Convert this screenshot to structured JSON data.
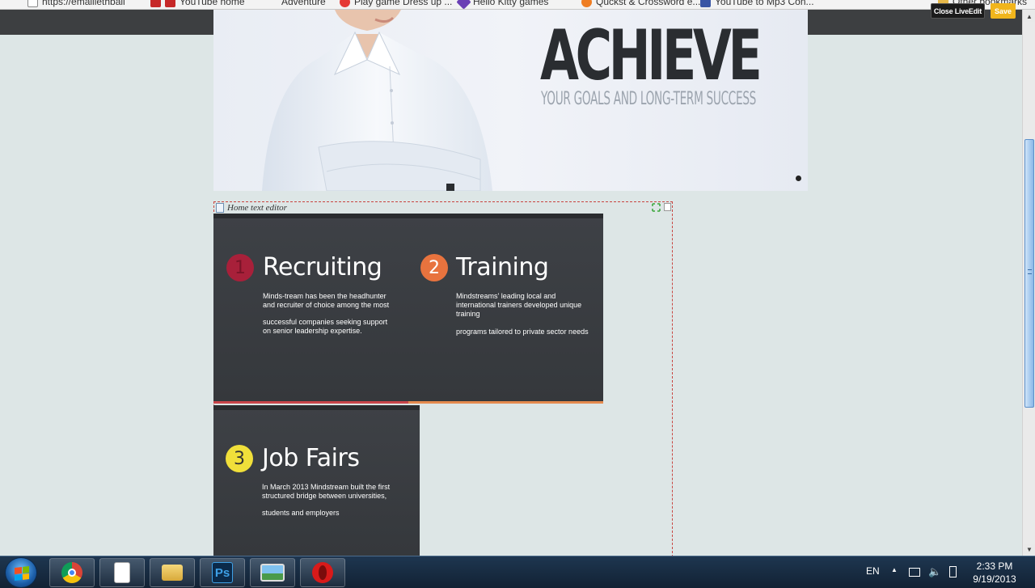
{
  "browser": {
    "bookmarks": [
      {
        "label": "https://emailiethbail",
        "icon": "page-icon"
      },
      {
        "label": "YouTube home",
        "icon": "youtube-icon"
      },
      {
        "label": "Adventure",
        "icon": "folder-icon"
      },
      {
        "label": "Play game Dress up ...",
        "icon": "game-icon"
      },
      {
        "label": "Hello Kitty games",
        "icon": "kitty-icon"
      },
      {
        "label": "Quckst & Crossword e...",
        "icon": "puzzle-icon"
      },
      {
        "label": "YouTube to Mp3 Con...",
        "icon": "mp3-icon"
      },
      {
        "label": "Other bookmarks",
        "icon": "folder-icon"
      }
    ]
  },
  "liveedit": {
    "close_label": "Close LiveEdit",
    "save_label": "Save",
    "editor_label": "Home text editor"
  },
  "hero": {
    "title": "ACHIEVE",
    "subtitle": "YOUR GOALS AND LONG-TERM SUCCESS"
  },
  "services": [
    {
      "number": "1",
      "title": "Recruiting",
      "color": "#a8203a",
      "text1": "Minds-tream has been the headhunter and recruiter of choice among the most",
      "text2": "successful companies seeking support on senior leadership expertise."
    },
    {
      "number": "2",
      "title": "Training",
      "color": "#e8733e",
      "text1": "Mindstreams' leading local and international trainers developed unique training",
      "text2": "programs tailored to private sector needs"
    },
    {
      "number": "3",
      "title": "Job Fairs",
      "color": "#f0df3a",
      "text1": "In March 2013 Mindstream built the first structured bridge between universities,",
      "text2": "students and employers"
    }
  ],
  "taskbar": {
    "apps": [
      "chrome-icon",
      "document-icon",
      "explorer-icon",
      "photoshop-icon",
      "image-viewer-icon",
      "opera-icon"
    ],
    "photoshop_label": "Ps",
    "language": "EN",
    "time": "2:33 PM",
    "date": "9/19/2013"
  }
}
